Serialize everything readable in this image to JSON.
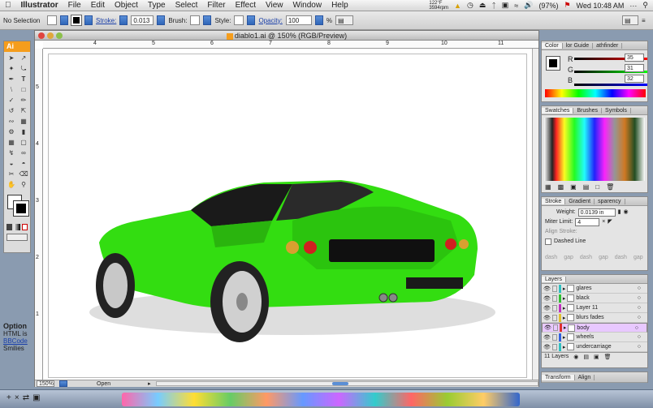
{
  "menubar": {
    "app_name": "Illustrator",
    "items": [
      "File",
      "Edit",
      "Object",
      "Type",
      "Select",
      "Filter",
      "Effect",
      "View",
      "Window",
      "Help"
    ],
    "temp": "122°F",
    "rpm": "3594rpm",
    "battery": "(97%)",
    "clock": "Wed 10:48 AM"
  },
  "control_bar": {
    "selection": "No Selection",
    "stroke_label": "Stroke:",
    "stroke_value": "0.013",
    "brush_label": "Brush:",
    "style_label": "Style:",
    "opacity_label": "Opacity:",
    "opacity_value": "100",
    "opacity_unit": "%"
  },
  "document": {
    "title": "diablo1.ai @ 150% (RGB/Preview)",
    "ruler_ticks": [
      "4",
      "5",
      "6",
      "7",
      "8",
      "9",
      "10",
      "11"
    ],
    "vruler_ticks": [
      "5",
      "4",
      "3",
      "2",
      "1"
    ],
    "zoom": "150%",
    "status": "Open"
  },
  "tools": {
    "header": "Ai"
  },
  "color_panel": {
    "tabs": [
      "Color",
      "lor Guide",
      "athfinder"
    ],
    "r_label": "R",
    "r_value": "35",
    "g_label": "G",
    "g_value": "31",
    "b_label": "B",
    "b_value": "32"
  },
  "swatches_panel": {
    "tabs": [
      "Swatches",
      "Brushes",
      "Symbols"
    ]
  },
  "stroke_panel": {
    "tabs": [
      "Stroke",
      "Gradient",
      "sparency"
    ],
    "weight_label": "Weight:",
    "weight_value": "0.0139 in",
    "miter_label": "Miter Limit:",
    "miter_value": "4",
    "align_label": "Align Stroke:",
    "dashed_label": "Dashed Line",
    "dash_labels": [
      "dash",
      "gap",
      "dash",
      "gap",
      "dash",
      "gap"
    ]
  },
  "layers_panel": {
    "tab": "Layers",
    "layers": [
      {
        "name": "glares",
        "color": "#30c0c0",
        "selected": false
      },
      {
        "name": "black",
        "color": "#30c030",
        "selected": false
      },
      {
        "name": "Layer 11",
        "color": "#c030c0",
        "selected": false
      },
      {
        "name": "blurs fades",
        "color": "#e0c030",
        "selected": false
      },
      {
        "name": "body",
        "color": "#e03030",
        "selected": true
      },
      {
        "name": "wheels",
        "color": "#3060e0",
        "selected": false
      },
      {
        "name": "undercarriage",
        "color": "#30c0c0",
        "selected": false
      }
    ],
    "count": "11 Layers"
  },
  "bottom_tabs": [
    "Transform",
    "Align"
  ],
  "side_text": {
    "title": "Option",
    "l1": "HTML is",
    "l2": "BBCode",
    "l3": "Smilies"
  },
  "colors": {
    "car_body": "#33dd11",
    "car_dark": "#1f9a0a",
    "ai_orange": "#f59d1c",
    "selected_layer": "#e8c8ff"
  }
}
